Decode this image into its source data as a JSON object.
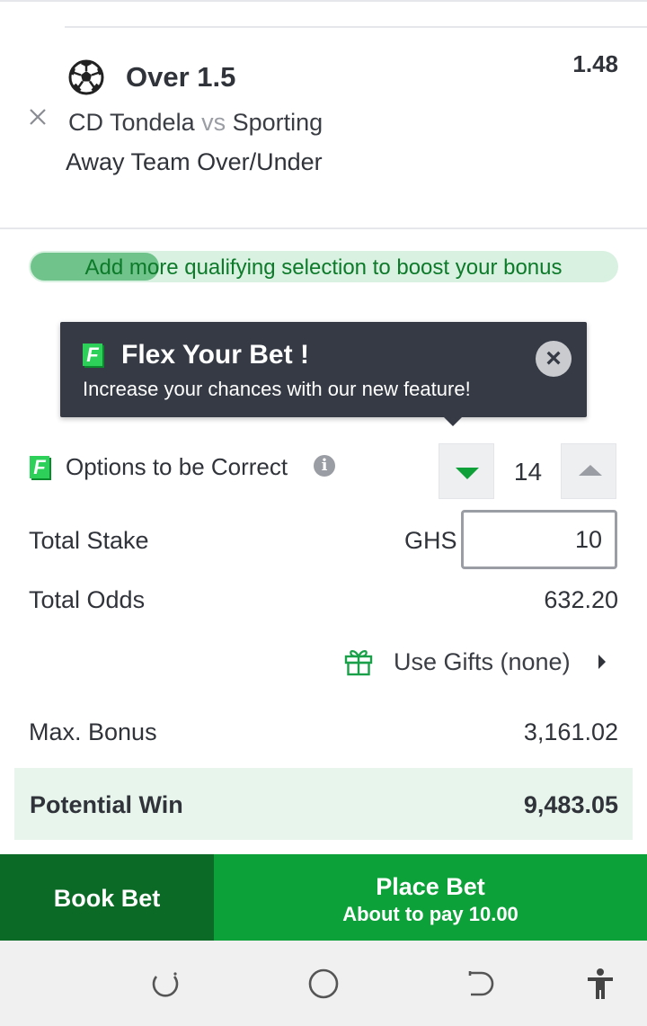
{
  "selection": {
    "title": "Over 1.5",
    "odds": "1.48",
    "home_team": "CD Tondela",
    "vs": "vs",
    "away_team": "Sporting",
    "market": "Away Team Over/Under"
  },
  "bonus": {
    "text": "Add more qualifying selection to boost your bonus",
    "progress_fraction": 0.22
  },
  "tooltip": {
    "badge": "F",
    "title": "Flex Your Bet !",
    "subtitle": "Increase your chances with our new feature!",
    "close": "×"
  },
  "options": {
    "badge": "F",
    "label": "Options to be Correct",
    "info": "i",
    "value": "14"
  },
  "stake": {
    "label": "Total Stake",
    "currency": "GHS",
    "value": "10"
  },
  "odds": {
    "label": "Total Odds",
    "value": "632.20"
  },
  "gifts": {
    "label": "Use Gifts (none)"
  },
  "max_bonus": {
    "label": "Max. Bonus",
    "value": "3,161.02"
  },
  "potential_win": {
    "label": "Potential Win",
    "value": "9,483.05"
  },
  "buttons": {
    "book_bet": "Book Bet",
    "place_bet": "Place Bet",
    "place_sub": "About to pay 10.00"
  },
  "colors": {
    "brand_green": "#0da13a",
    "dark_green": "#0b6b26",
    "tooltip_bg": "#353a45"
  },
  "icons": [
    "soccer-ball-icon",
    "close-icon",
    "info-icon",
    "gift-icon",
    "caret-right-icon",
    "rotate-icon",
    "home-icon",
    "back-icon",
    "accessibility-icon"
  ]
}
